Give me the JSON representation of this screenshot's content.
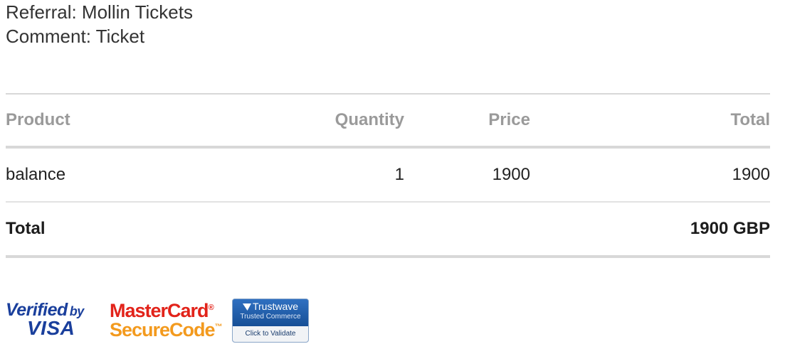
{
  "meta": {
    "referral": "Referral: Mollin Tickets",
    "comment": "Comment: Ticket"
  },
  "table": {
    "headers": {
      "product": "Product",
      "quantity": "Quantity",
      "price": "Price",
      "total": "Total"
    },
    "rows": [
      {
        "product": "balance",
        "quantity": "1",
        "price": "1900",
        "total": "1900"
      }
    ],
    "footer": {
      "label": "Total",
      "amount": "1900 GBP"
    }
  },
  "badges": {
    "visa": {
      "line1": "Verified",
      "by": "by",
      "line2": "VISA",
      "color": "#1a3f9c"
    },
    "mastercard": {
      "line1": "MasterCard",
      "line2": "SecureCode",
      "red": "#e2231a",
      "orange": "#f39a1e"
    },
    "trustwave": {
      "name": "Trustwave",
      "subtitle": "Trusted Commerce",
      "validate": "Click to Validate",
      "color": "#1e5aa8"
    }
  }
}
